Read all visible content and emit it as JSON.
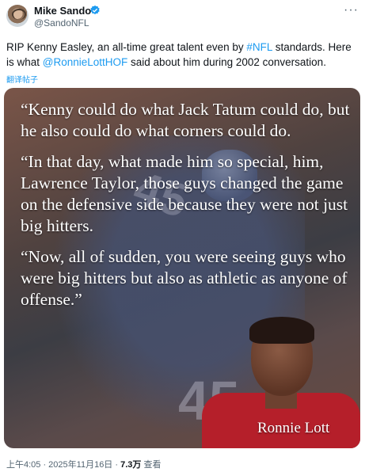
{
  "author": {
    "name": "Mike Sando",
    "handle": "@SandoNFL"
  },
  "tweet": {
    "text_1": "RIP Kenny Easley, an all-time great talent even by ",
    "hashtag": "#NFL",
    "text_2": " standards. Here is what ",
    "mention": "@RonnieLottHOF",
    "text_3": " said about him during 2002 conversation.",
    "translate_label": "翻译帖子"
  },
  "media": {
    "quotes": [
      "“Kenny could do what Jack Tatum could do, but he also could do what corners could do.",
      "“In that day, what made him so special, him, Lawrence Taylor, those guys changed the game on the defensive side because they were not just big hitters.",
      "“Now, all of sudden, you were seeing guys who were big hitters but also as athletic as anyone of offense.”"
    ],
    "signature": "Ronnie Lott",
    "jersey_number": "45"
  },
  "meta": {
    "time": "上午4:05 · 2025年11月16日 · ",
    "views": "7.3万",
    "views_label": " 查看"
  },
  "colors": {
    "link": "#1d9bf0",
    "verified": "#1d9bf0"
  }
}
